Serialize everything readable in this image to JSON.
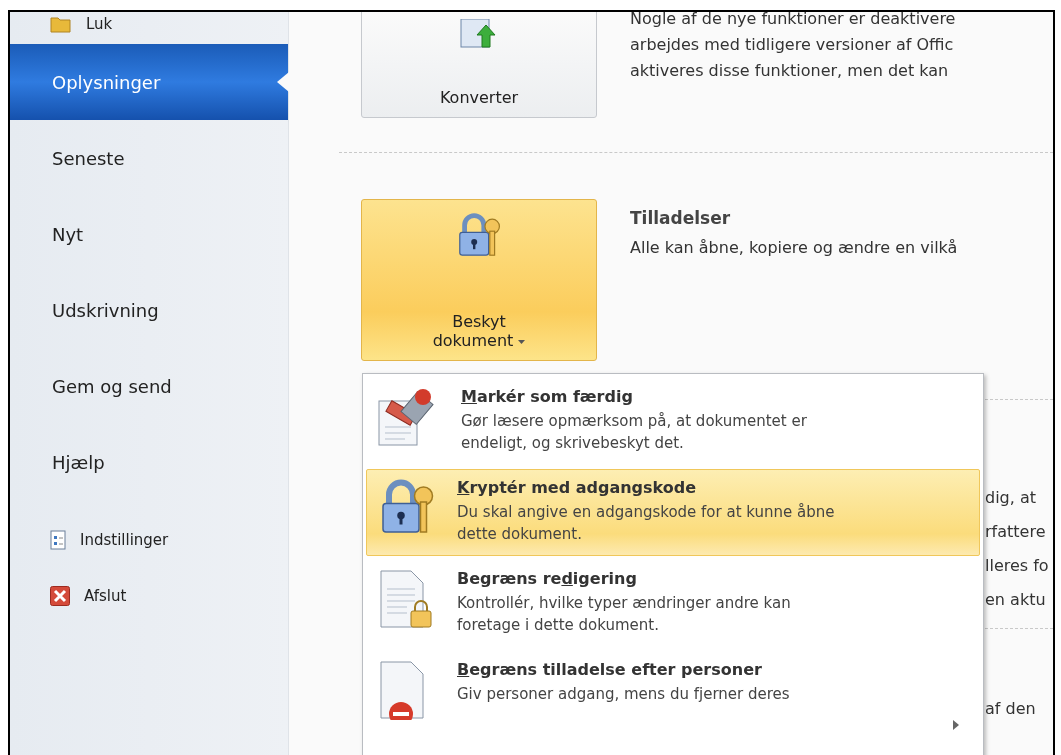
{
  "sidebar": {
    "items": [
      {
        "label": "Luk",
        "kind": "small",
        "selected": false
      },
      {
        "label": "Oplysninger",
        "kind": "large",
        "selected": true
      },
      {
        "label": "Seneste",
        "kind": "large",
        "selected": false
      },
      {
        "label": "Nyt",
        "kind": "large",
        "selected": false
      },
      {
        "label": "Udskrivning",
        "kind": "large",
        "selected": false
      },
      {
        "label": "Gem og send",
        "kind": "large",
        "selected": false
      },
      {
        "label": "Hjælp",
        "kind": "large",
        "selected": false
      },
      {
        "label": "Indstillinger",
        "kind": "small",
        "selected": false
      },
      {
        "label": "Afslut",
        "kind": "small",
        "selected": false
      }
    ]
  },
  "sections": [
    {
      "button": {
        "label_lines": [
          "Konverter"
        ],
        "highlighted": false,
        "dropdown": false
      },
      "lines": [
        "Nogle af de nye funktioner er deaktivere",
        "arbejdes med tidligere versioner af Offic",
        "aktiveres disse funktioner, men det kan"
      ]
    },
    {
      "button": {
        "label_lines": [
          "Beskyt",
          "dokument"
        ],
        "highlighted": true,
        "dropdown": true
      },
      "title": "Tilladelser",
      "lines": [
        "Alle kan åbne, kopiere og ændre en vilkå"
      ]
    }
  ],
  "hidden_section": {
    "lines": [
      "dig, at",
      "rfattere",
      "lleres fo",
      "en aktu"
    ],
    "after_divider": [
      "af den"
    ]
  },
  "menu": {
    "items": [
      {
        "title_key": "M",
        "title_after": "arkér som færdig",
        "description": "Gør læsere opmærksom på, at dokumentet er endeligt, og skrivebeskyt det.",
        "selected": false,
        "submenu": false
      },
      {
        "title_key": "K",
        "title_after": "ryptér med adgangskode",
        "description": "Du skal angive en adgangskode for at kunne åbne dette dokument.",
        "selected": true,
        "submenu": false
      },
      {
        "title_before": "Begræns re",
        "title_key": "d",
        "title_after": "igering",
        "description": "Kontrollér, hvilke typer ændringer andre kan foretage i dette dokument.",
        "selected": false,
        "submenu": false
      },
      {
        "title_key": "B",
        "title_after": "egræns tilladelse efter personer",
        "description": "Giv personer adgang, mens du fjerner deres",
        "selected": false,
        "submenu": true
      }
    ]
  }
}
